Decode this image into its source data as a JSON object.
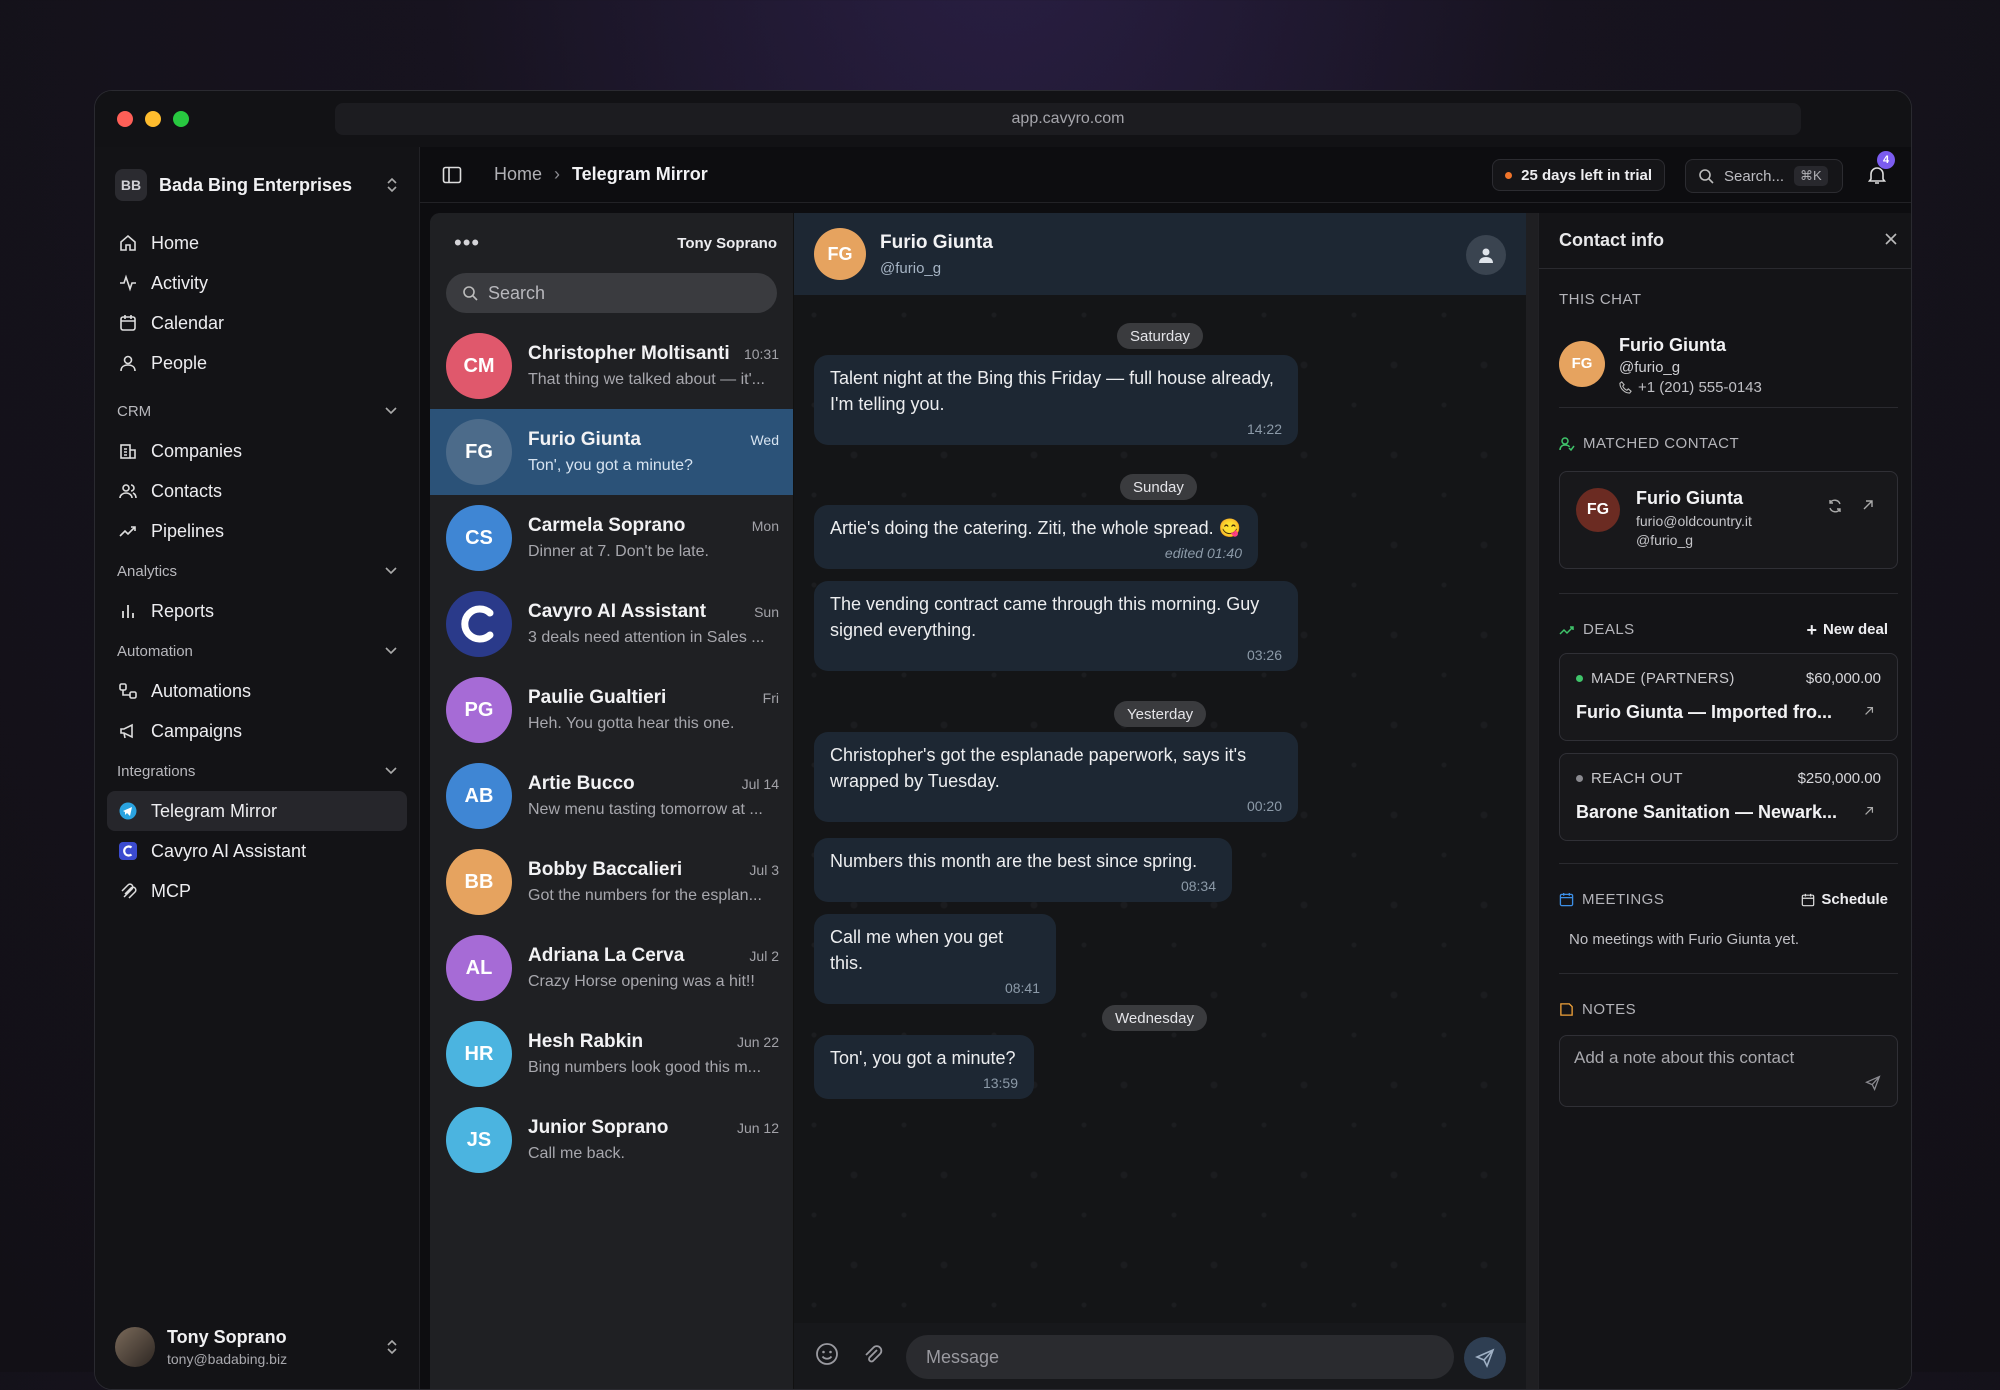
{
  "browser": {
    "url": "app.cavyro.com"
  },
  "workspace": {
    "badge": "BB",
    "name": "Bada Bing Enterprises"
  },
  "nav": {
    "main": [
      {
        "label": "Home",
        "icon": "home-icon"
      },
      {
        "label": "Activity",
        "icon": "activity-icon"
      },
      {
        "label": "Calendar",
        "icon": "calendar-icon"
      },
      {
        "label": "People",
        "icon": "person-icon"
      }
    ],
    "crm_label": "CRM",
    "crm": [
      {
        "label": "Companies"
      },
      {
        "label": "Contacts"
      },
      {
        "label": "Pipelines"
      }
    ],
    "analytics_label": "Analytics",
    "analytics": [
      {
        "label": "Reports"
      }
    ],
    "automation_label": "Automation",
    "automation": [
      {
        "label": "Automations"
      },
      {
        "label": "Campaigns"
      }
    ],
    "integrations_label": "Integrations",
    "integrations": [
      {
        "label": "Telegram Mirror"
      },
      {
        "label": "Cavyro AI Assistant"
      },
      {
        "label": "MCP"
      }
    ]
  },
  "user": {
    "name": "Tony Soprano",
    "email": "tony@badabing.biz"
  },
  "topbar": {
    "crumb_home": "Home",
    "crumb_current": "Telegram Mirror",
    "trial": "25 days left in trial",
    "search": "Search...",
    "shortcut": "⌘K",
    "notifications": "4"
  },
  "chat_list": {
    "account": "Tony Soprano",
    "search_placeholder": "Search",
    "chats": [
      {
        "initials": "CM",
        "name": "Christopher Moltisanti",
        "time": "10:31",
        "preview": "That thing we talked about — it'...",
        "color": "#e0586c"
      },
      {
        "initials": "FG",
        "name": "Furio Giunta",
        "time": "Wed",
        "preview": "Ton', you got a minute?",
        "color": "#4c6b8a"
      },
      {
        "initials": "CS",
        "name": "Carmela Soprano",
        "time": "Mon",
        "preview": "Dinner at 7. Don't be late.",
        "color": "#3f86d4"
      },
      {
        "initials": "",
        "name": "Cavyro AI Assistant",
        "time": "Sun",
        "preview": "3 deals need attention in Sales ...",
        "color": "#2a3a8a"
      },
      {
        "initials": "PG",
        "name": "Paulie Gualtieri",
        "time": "Fri",
        "preview": "Heh. You gotta hear this one.",
        "color": "#a66bd6"
      },
      {
        "initials": "AB",
        "name": "Artie Bucco",
        "time": "Jul 14",
        "preview": "New menu tasting tomorrow at ...",
        "color": "#3f86d4"
      },
      {
        "initials": "BB",
        "name": "Bobby Baccalieri",
        "time": "Jul 3",
        "preview": "Got the numbers for the esplan...",
        "color": "#e6a35f"
      },
      {
        "initials": "AL",
        "name": "Adriana La Cerva",
        "time": "Jul 2",
        "preview": "Crazy Horse opening was a hit!!",
        "color": "#a66bd6"
      },
      {
        "initials": "HR",
        "name": "Hesh Rabkin",
        "time": "Jun 22",
        "preview": "Bing numbers look good this m...",
        "color": "#4bb4e0"
      },
      {
        "initials": "JS",
        "name": "Junior Soprano",
        "time": "Jun 12",
        "preview": "Call me back.",
        "color": "#4bb4e0"
      }
    ]
  },
  "conversation": {
    "initials": "FG",
    "name": "Furio Giunta",
    "handle": "@furio_g",
    "days": [
      "Saturday",
      "Sunday",
      "Yesterday",
      "Wednesday"
    ],
    "messages": [
      {
        "text": "Talent night at the Bing this Friday — full house already, I'm telling you.",
        "time": "14:22"
      },
      {
        "text": "Artie's doing the catering. Ziti, the whole spread. 😋",
        "time": "edited 01:40"
      },
      {
        "text": "The vending contract came through this morning. Guy signed everything.",
        "time": "03:26"
      },
      {
        "text": "Christopher's got the esplanade paperwork, says it's wrapped by Tuesday.",
        "time": "00:20"
      },
      {
        "text": "Numbers this month are the best since spring.",
        "time": "08:34"
      },
      {
        "text": "Call me when you get this.",
        "time": "08:41"
      },
      {
        "text": "Ton', you got a minute?",
        "time": "13:59"
      }
    ],
    "composer_placeholder": "Message"
  },
  "contact_info": {
    "title": "Contact info",
    "this_chat_label": "THIS CHAT",
    "chat_initials": "FG",
    "chat_name": "Furio Giunta",
    "chat_handle": "@furio_g",
    "chat_phone": "+1 (201) 555-0143",
    "matched_label": "MATCHED CONTACT",
    "matched_initials": "FG",
    "matched_name": "Furio Giunta",
    "matched_email": "furio@oldcountry.it",
    "matched_handle": "@furio_g",
    "deals_label": "DEALS",
    "new_deal": "New deal",
    "deals": [
      {
        "stage": "MADE (PARTNERS)",
        "amount": "$60,000.00",
        "title": "Furio Giunta — Imported fro...",
        "dot": "#3fc46a"
      },
      {
        "stage": "REACH OUT",
        "amount": "$250,000.00",
        "title": "Barone Sanitation — Newark...",
        "dot": "#8a8a90"
      }
    ],
    "meetings_label": "MEETINGS",
    "schedule": "Schedule",
    "no_meetings": "No meetings with Furio Giunta yet.",
    "notes_label": "NOTES",
    "note_placeholder": "Add a note about this contact"
  }
}
